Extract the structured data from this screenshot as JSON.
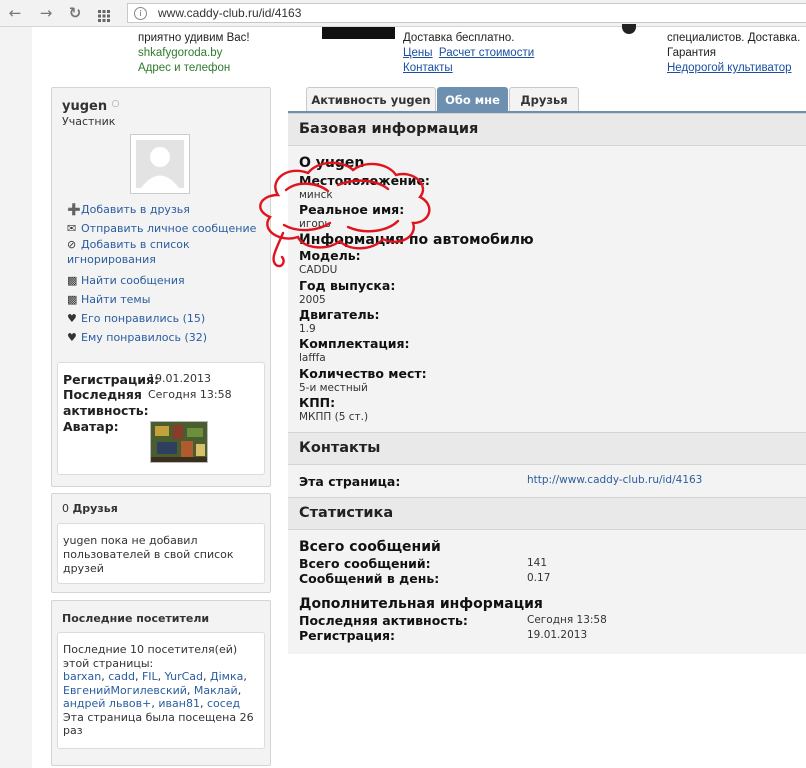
{
  "browser": {
    "url": "www.caddy-club.ru/id/4163",
    "back_icon": "arrow-left",
    "forward_icon": "arrow-right",
    "reload_icon": "reload",
    "apps_icon": "grid"
  },
  "ads": {
    "ad1_line1": "приятно удивим Вас!",
    "ad1_site": "shkafygoroda.by",
    "ad1_address": "Адрес и телефон",
    "ad2_line1": "Доставка бесплатно.",
    "ad2_link_prices": "Цены",
    "ad2_link_calc": "Расчет стоимости",
    "ad2_link_contacts": "Контакты",
    "ad3_line1": "специалистов. Доставка.",
    "ad3_line2": "Гарантия",
    "ad3_link": "Недорогой культиватор"
  },
  "profile": {
    "username": "yugen",
    "status_icon": "offline-circle",
    "role": "Участник",
    "actions": [
      {
        "icon": "plus-icon",
        "label": "Добавить в друзья"
      },
      {
        "icon": "envelope-icon",
        "label": "Отправить личное сообщение"
      },
      {
        "icon": "block-icon",
        "label": "Добавить в список игнорирования"
      },
      {
        "icon": "messages-icon",
        "label": "Найти сообщения"
      },
      {
        "icon": "messages-icon",
        "label": "Найти темы"
      },
      {
        "icon": "heart-icon",
        "label": "Его понравились (15)"
      },
      {
        "icon": "heart-icon",
        "label": "Ему понравилось (32)"
      }
    ],
    "reg_label": "Регистрация:",
    "reg_value": "19.01.2013",
    "last_active_label": "Последняя активность:",
    "last_active_label_1": "Последняя",
    "last_active_label_2": "активность:",
    "last_active_value": "Сегодня 13:58",
    "avatar_label": "Аватар:"
  },
  "friends": {
    "count": "0",
    "title": "Друзья",
    "empty_text": "yugen пока не добавил пользователей в свой список друзей"
  },
  "visitors": {
    "title": "Последние посетители",
    "intro": "Последние 10 посетителя(ей) этой страницы:",
    "names": [
      "barxan",
      "cadd",
      "FIL",
      "YurCad",
      "Дімка",
      "ЕвгенийМогилевский",
      "Маклай",
      "андрей львов+",
      "иван81",
      "сосед"
    ],
    "visits_text": "Эта страница была посещена 26 раз"
  },
  "tabs": [
    {
      "label": "Активность yugen",
      "active": false
    },
    {
      "label": "Обо мне",
      "active": true
    },
    {
      "label": "Друзья",
      "active": false
    }
  ],
  "basic": {
    "title": "Базовая информация",
    "about_heading": "О yugen",
    "location_label": "Местоположение:",
    "location_value": "минск",
    "realname_label": "Реальное имя:",
    "realname_value": "игорь",
    "car_heading": "Информация по автомобилю",
    "model_label": "Модель:",
    "model_value": "CADDU",
    "year_label": "Год выпуска:",
    "year_value": "2005",
    "engine_label": "Двигатель:",
    "engine_value": "1.9",
    "trim_label": "Комплектация:",
    "trim_value": "lafffa",
    "seats_label": "Количество мест:",
    "seats_value": "5-и местный",
    "gearbox_label": "КПП:",
    "gearbox_value": "МКПП (5 ст.)"
  },
  "contacts": {
    "title": "Контакты",
    "page_label": "Эта страница:",
    "page_value": "http://www.caddy-club.ru/id/4163"
  },
  "stats": {
    "title": "Статистика",
    "posts_heading": "Всего сообщений",
    "total_label": "Всего сообщений:",
    "total_value": "141",
    "perday_label": "Сообщений в день:",
    "perday_value": "0.17",
    "extra_heading": "Дополнительная информация",
    "last_label": "Последняя активность:",
    "last_value": "Сегодня 13:58",
    "reg_label": "Регистрация:",
    "reg_value": "19.01.2013"
  },
  "colors": {
    "link": "#2a5d9f",
    "active_tab": "#6d8fb0",
    "scribble": "#e0141e"
  }
}
